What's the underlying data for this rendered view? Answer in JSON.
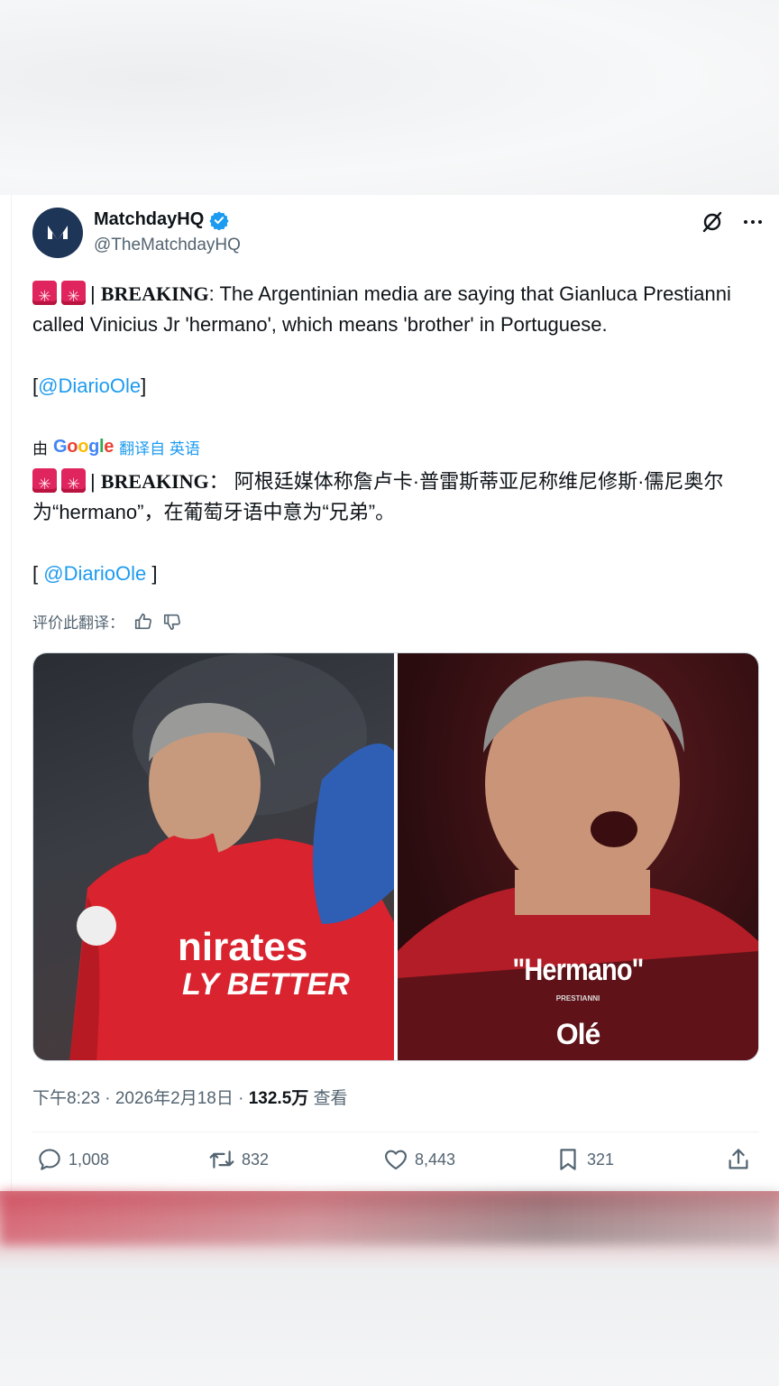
{
  "account": {
    "display_name": "MatchdayHQ",
    "handle": "@TheMatchdayHQ"
  },
  "tweet": {
    "breaking_label": "BREAKING",
    "text_en_rest": ": The Argentinian media are saying that Gianluca Prestianni called Vinicius Jr 'hermano', which means 'brother' in Portuguese.",
    "source_open": "[",
    "source_link": "@DiarioOle",
    "source_close": "]",
    "by_label": "由",
    "google_label": "Google",
    "translated_from": "翻译自 英语",
    "breaking_label_zh": "BREAKING",
    "text_zh_rest": "： 阿根廷媒体称詹卢卡·普雷斯蒂亚尼称维尼修斯·儒尼奥尔为“hermano”，在葡萄牙语中意为“兄弟”。",
    "source_open_zh": "[ ",
    "source_link_zh": "@DiarioOle",
    "source_close_zh": " ]",
    "rate_translation": "评价此翻译："
  },
  "media": {
    "caption": "\"Hermano\"",
    "caption_sub": "PRESTIANNI",
    "caption_logo": "Olé"
  },
  "meta": {
    "time_date": "下午8:23 · 2026年2月18日 · ",
    "views": "132.5万",
    "views_label": " 查看"
  },
  "actions": {
    "replies": "1,008",
    "retweets": "832",
    "likes": "8,443",
    "bookmarks": "321"
  },
  "colors": {
    "accent": "#1d9bf0",
    "text": "#0f1419",
    "secondary": "#536471"
  }
}
